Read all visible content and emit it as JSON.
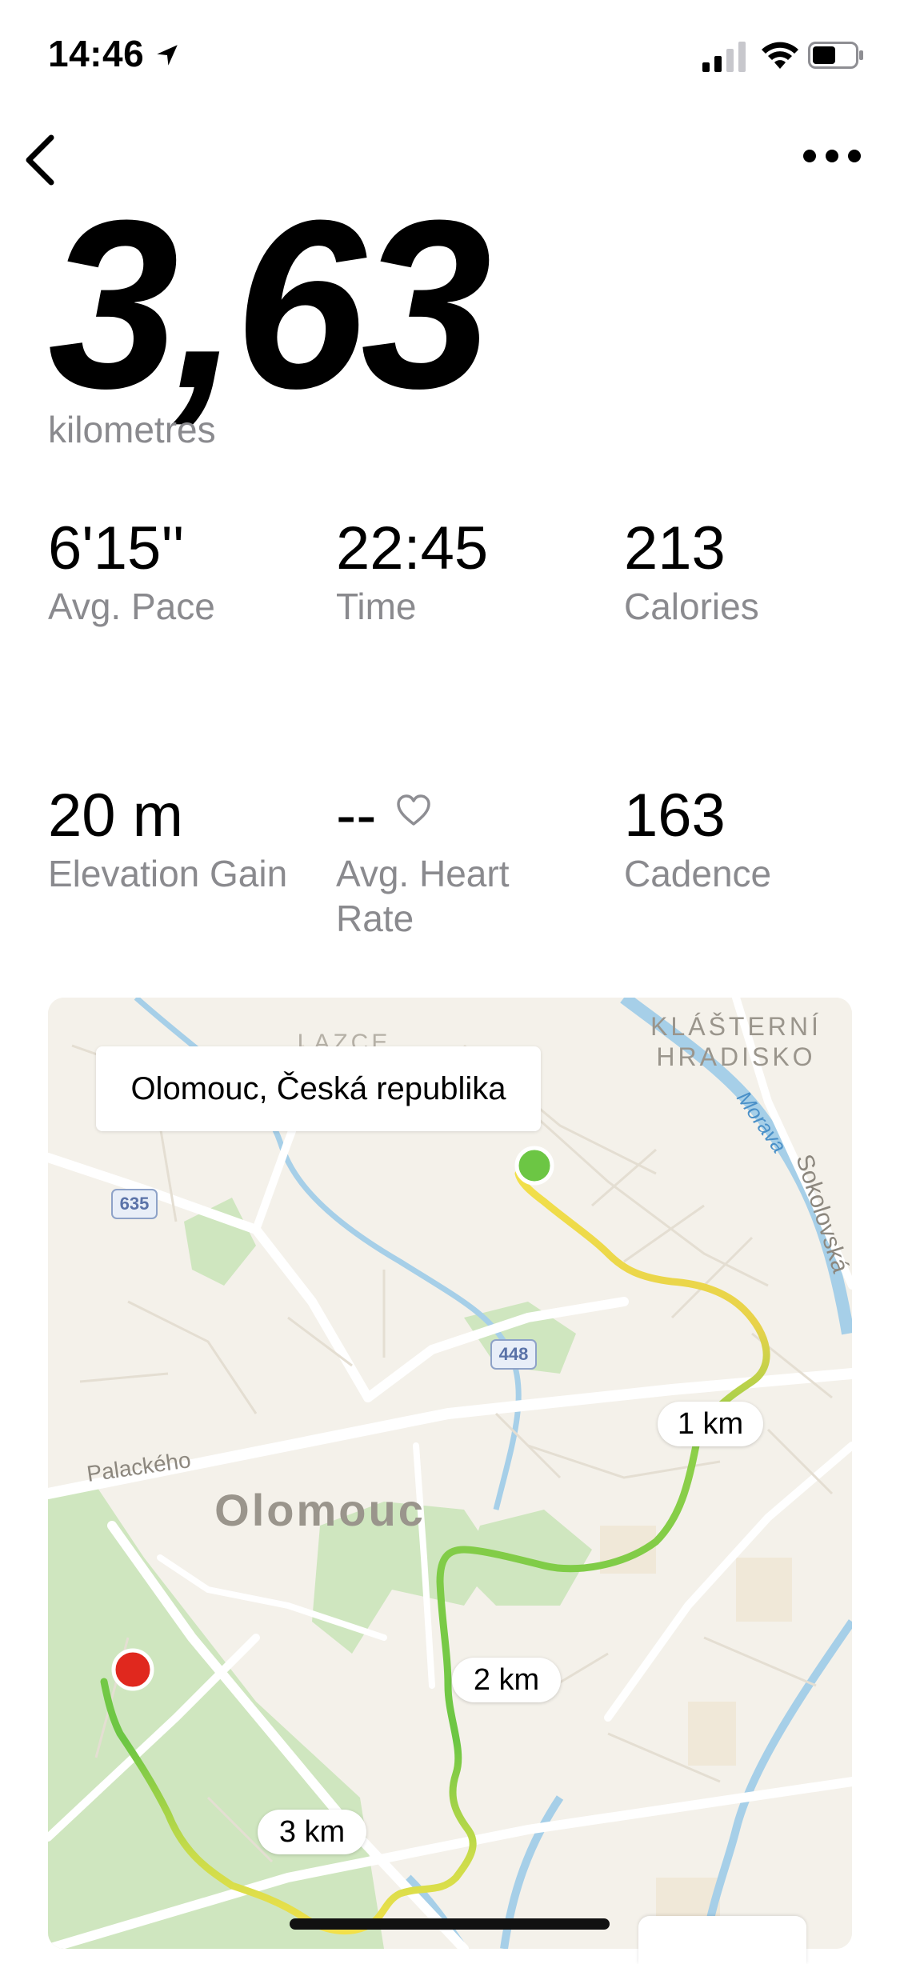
{
  "status_bar": {
    "time": "14:46",
    "icons": [
      "location-arrow-icon",
      "cellular-signal-icon",
      "wifi-icon",
      "battery-icon"
    ]
  },
  "nav": {
    "back_icon": "chevron-left-icon",
    "more_icon": "ellipsis-icon"
  },
  "summary": {
    "distance": "3,63",
    "unit": "kilometres"
  },
  "stats": [
    {
      "value": "6'15''",
      "label": "Avg. Pace"
    },
    {
      "value": "22:45",
      "label": "Time"
    },
    {
      "value": "213",
      "label": "Calories"
    },
    {
      "value": "20 m",
      "label": "Elevation Gain"
    },
    {
      "value": "--",
      "label": "Avg. Heart Rate",
      "icon": "heart-outline-icon"
    },
    {
      "value": "163",
      "label": "Cadence"
    }
  ],
  "map": {
    "location": "Olomouc, Česká republika",
    "city_label": "Olomouc",
    "district_label": "KLÁŠTERNÍ HRADISKO",
    "district_label_partial": "LAZCE",
    "river_label": "Morava",
    "street_labels": [
      "Sokolovská",
      "Palackého"
    ],
    "road_shields": [
      "635",
      "448"
    ],
    "km_markers": [
      "1 km",
      "2 km",
      "3 km"
    ],
    "start_color": "#6cc644",
    "end_color": "#e0281e",
    "route_colors": [
      "#f2e04a",
      "#a8d84a",
      "#6cc644"
    ]
  }
}
